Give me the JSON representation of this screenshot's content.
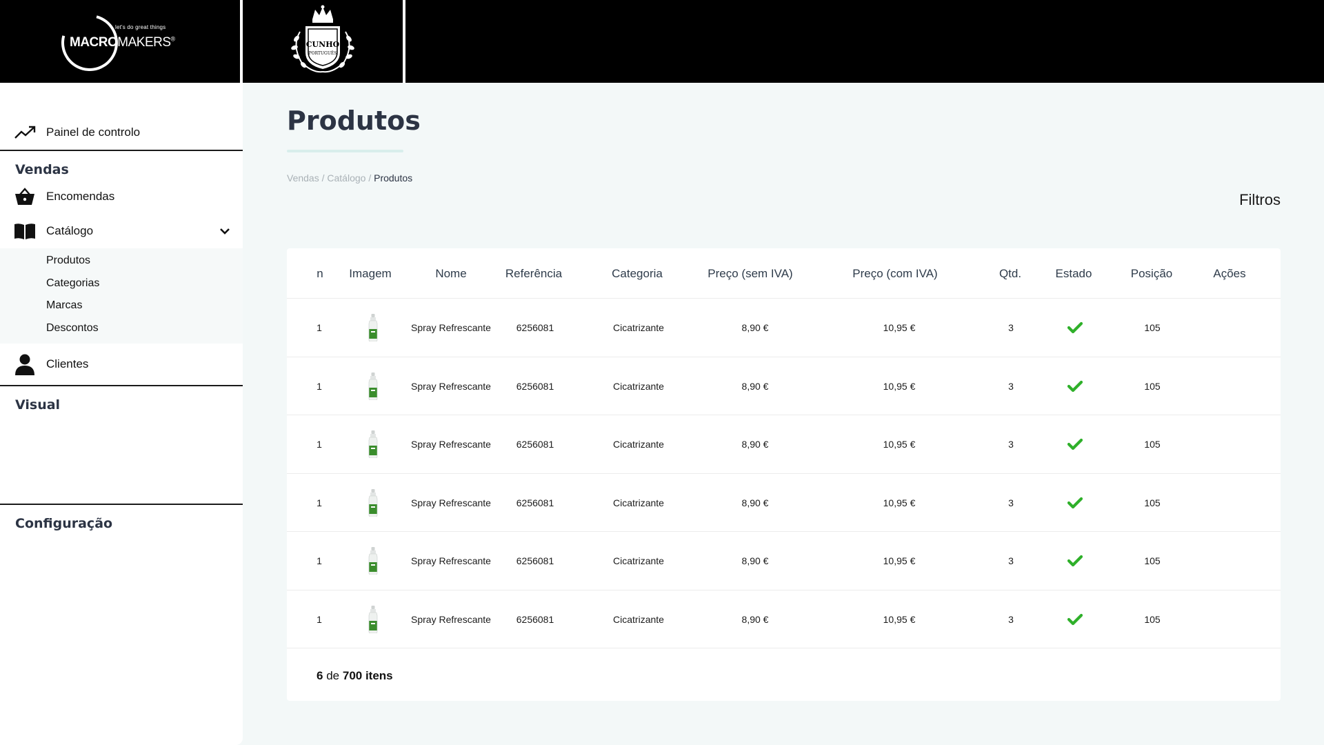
{
  "brand": {
    "tagline": "let's do great things",
    "name_bold": "MACRO",
    "name_light": "MAKERS",
    "reg": "®"
  },
  "client": {
    "line1": "CUNHO",
    "line2": "PORTUGUÊS"
  },
  "sidebar": {
    "dashboard": "Painel de controlo",
    "sections": {
      "sales": "Vendas",
      "visual": "Visual",
      "config": "Configuração"
    },
    "orders": "Encomendas",
    "catalog": "Catálogo",
    "catalog_items": [
      "Produtos",
      "Categorias",
      "Marcas",
      "Descontos"
    ],
    "clients": "Clientes"
  },
  "page": {
    "title": "Produtos",
    "breadcrumb": {
      "sales": "Vendas",
      "sep": " / ",
      "catalog": "Catálogo",
      "current": "Produtos"
    },
    "filters": "Filtros"
  },
  "table": {
    "headers": [
      "n",
      "Imagem",
      "Nome",
      "Referência",
      "Categoria",
      "Preço (sem IVA)",
      "Preço (com IVA)",
      "Qtd.",
      "Estado",
      "Posição",
      "Ações"
    ],
    "rows": [
      {
        "n": "1",
        "name": "Spray Refrescante",
        "ref": "6256081",
        "category": "Cicatrizante",
        "price_no_vat": "8,90 €",
        "price_vat": "10,95 €",
        "qty": "3",
        "status": "active",
        "position": "105"
      },
      {
        "n": "1",
        "name": "Spray Refrescante",
        "ref": "6256081",
        "category": "Cicatrizante",
        "price_no_vat": "8,90 €",
        "price_vat": "10,95 €",
        "qty": "3",
        "status": "active",
        "position": "105"
      },
      {
        "n": "1",
        "name": "Spray Refrescante",
        "ref": "6256081",
        "category": "Cicatrizante",
        "price_no_vat": "8,90 €",
        "price_vat": "10,95 €",
        "qty": "3",
        "status": "active",
        "position": "105"
      },
      {
        "n": "1",
        "name": "Spray Refrescante",
        "ref": "6256081",
        "category": "Cicatrizante",
        "price_no_vat": "8,90 €",
        "price_vat": "10,95 €",
        "qty": "3",
        "status": "active",
        "position": "105"
      },
      {
        "n": "1",
        "name": "Spray Refrescante",
        "ref": "6256081",
        "category": "Cicatrizante",
        "price_no_vat": "8,90 €",
        "price_vat": "10,95 €",
        "qty": "3",
        "status": "active",
        "position": "105"
      },
      {
        "n": "1",
        "name": "Spray Refrescante",
        "ref": "6256081",
        "category": "Cicatrizante",
        "price_no_vat": "8,90 €",
        "price_vat": "10,95 €",
        "qty": "3",
        "status": "active",
        "position": "105"
      }
    ],
    "footer": {
      "shown": "6",
      "of": "de",
      "total": "700 itens"
    }
  },
  "colors": {
    "check": "#2fb02a",
    "title": "#2c3444",
    "topbar": "#000000",
    "product_green": "#3a8d2c"
  },
  "icons": {
    "dashboard": "trend-up-icon",
    "orders": "basket-icon",
    "catalog": "book-icon",
    "clients": "person-icon",
    "expand": "chevron-down-icon",
    "status": "check-icon",
    "product": "spray-bottle-icon"
  }
}
